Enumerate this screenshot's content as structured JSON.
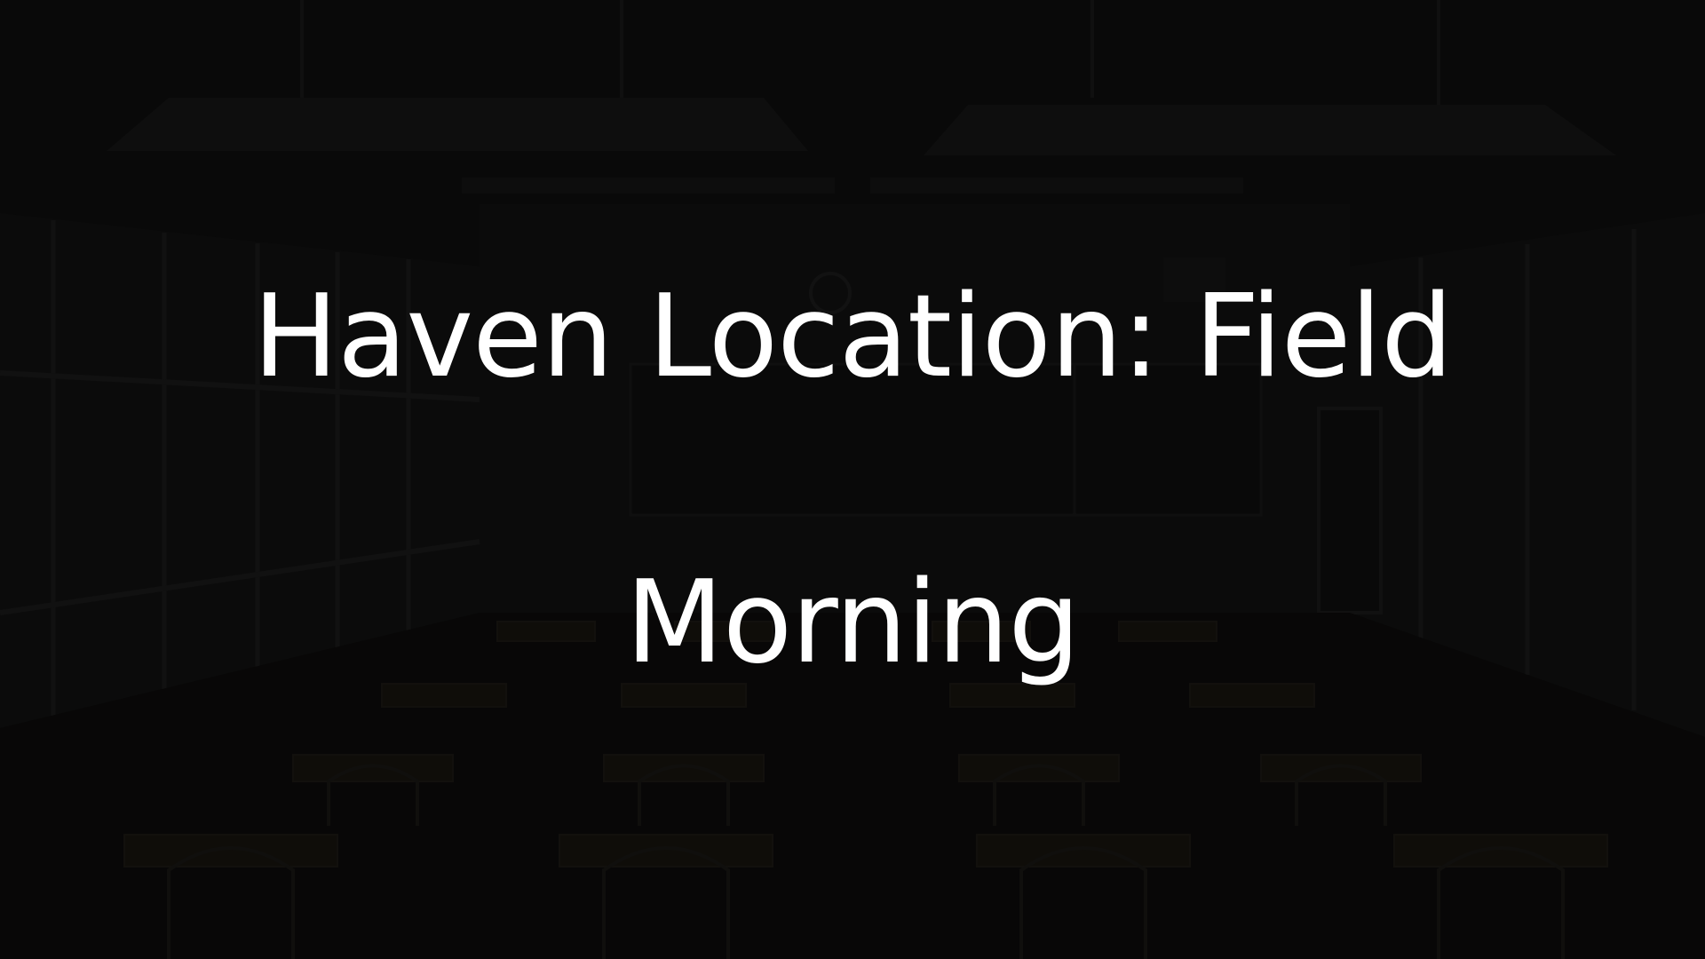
{
  "scene": {
    "background": "dark-classroom",
    "location_text": "Haven Location: Field",
    "time_text": "Morning"
  },
  "colors": {
    "text": "#ffffff",
    "background": "#0b0b0b"
  }
}
